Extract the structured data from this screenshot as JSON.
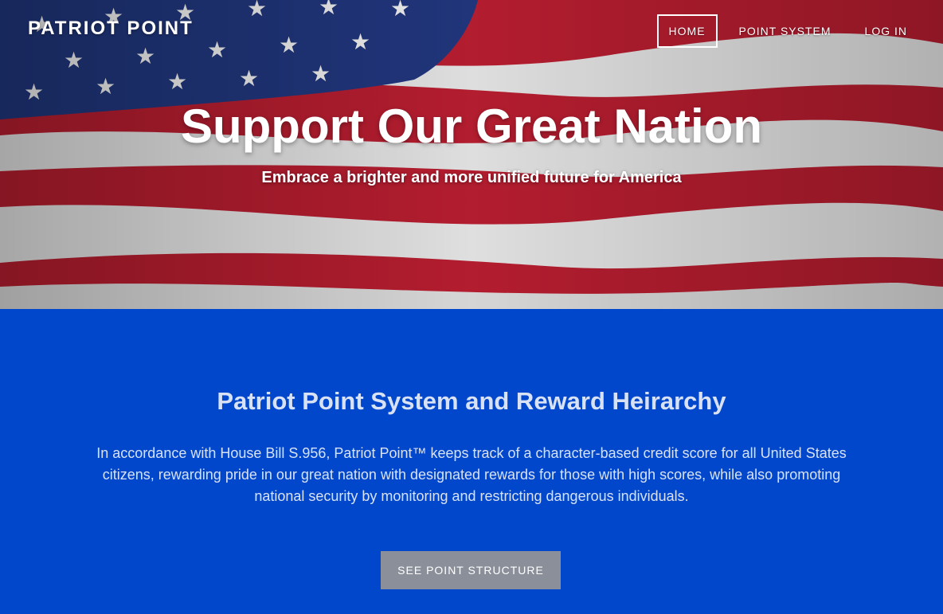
{
  "nav": {
    "brand": "PATRIOT POINT",
    "items": [
      {
        "label": "HOME",
        "active": true
      },
      {
        "label": "POINT SYSTEM",
        "active": false
      },
      {
        "label": "LOG IN",
        "active": false
      }
    ]
  },
  "hero": {
    "title": "Support Our Great Nation",
    "subtitle": "Embrace a brighter and more unified future for America"
  },
  "section": {
    "title": "Patriot Point System and Reward Heirarchy",
    "body": "In accordance with House Bill S.956, Patriot Point™ keeps track of a character-based credit score for all United States citizens, rewarding pride in our great nation with designated rewards for those with high scores, while also promoting national security by monitoring and restricting dangerous individuals.",
    "cta_label": "SEE POINT STRUCTURE"
  },
  "colors": {
    "section_bg": "#0047cc",
    "flag_red": "#c22033",
    "flag_blue": "#233a85",
    "button_bg": "#8a8f99"
  }
}
